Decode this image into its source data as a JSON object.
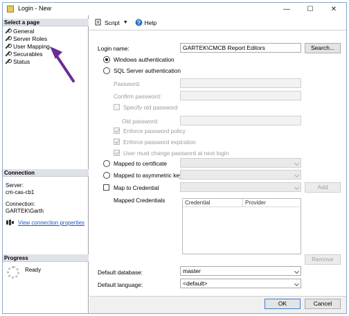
{
  "window": {
    "title": "Login - New",
    "controls": {
      "minimize": "—",
      "maximize": "☐",
      "close": "✕"
    }
  },
  "left_pane": {
    "select_page_header": "Select a page",
    "pages": [
      {
        "label": "General"
      },
      {
        "label": "Server Roles"
      },
      {
        "label": "User Mapping"
      },
      {
        "label": "Securables"
      },
      {
        "label": "Status"
      }
    ],
    "connection_header": "Connection",
    "server_label": "Server:",
    "server_value": "cm-cas-cb1",
    "connection_label": "Connection:",
    "connection_value": "GARTEK\\Garth",
    "view_connection_properties": "View connection properties",
    "progress_header": "Progress",
    "progress_status": "Ready"
  },
  "toolbar": {
    "script_label": "Script",
    "help_label": "Help"
  },
  "form": {
    "login_name_label": "Login name:",
    "login_name_value": "GARTEK\\CMCB Report Editors",
    "search_button": "Search...",
    "windows_auth_label": "Windows authentication",
    "sql_auth_label": "SQL Server authentication",
    "password_label": "Password:",
    "confirm_password_label": "Confirm password:",
    "specify_old_password_label": "Specify old password",
    "old_password_label": "Old password:",
    "enforce_policy_label": "Enforce password policy",
    "enforce_expiration_label": "Enforce password expiration",
    "must_change_label": "User must change password at next login",
    "mapped_certificate_label": "Mapped to certificate",
    "mapped_asym_key_label": "Mapped to asymmetric key",
    "map_credential_label": "Map to Credential",
    "add_button": "Add",
    "mapped_credentials_label": "Mapped Credentials",
    "grid_columns": [
      "Credential",
      "Provider"
    ],
    "remove_button": "Remove",
    "default_database_label": "Default database:",
    "default_database_value": "master",
    "default_language_label": "Default language:",
    "default_language_value": "<default>"
  },
  "footer": {
    "ok_button": "OK",
    "cancel_button": "Cancel"
  },
  "colors": {
    "accent": "#3c7fd1",
    "link": "#1a56c4",
    "annotation_arrow": "#6a2c91"
  }
}
